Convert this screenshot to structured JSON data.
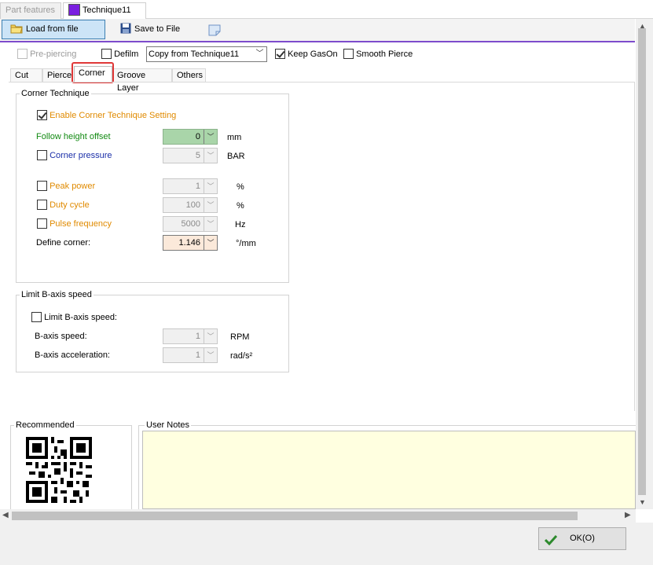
{
  "tabs": {
    "part_features": "Part features",
    "technique": "Technique11"
  },
  "toolbar": {
    "load": "Load from file",
    "save": "Save to File"
  },
  "options": {
    "pre_piercing": "Pre-piercing",
    "defilm": "Defilm",
    "copy_from": "Copy from Technique11",
    "keep_gas_on": "Keep GasOn",
    "smooth_pierce": "Smooth Pierce"
  },
  "subtabs": [
    "Cut",
    "Pierce",
    "Corner",
    "Groove Layer",
    "Others"
  ],
  "corner_group": {
    "title": "Corner Technique",
    "enable": "Enable Corner Technique Setting",
    "follow_height": {
      "label": "Follow height offset",
      "value": "0",
      "unit": "mm"
    },
    "corner_pressure": {
      "label": "Corner pressure",
      "value": "5",
      "unit": "BAR"
    },
    "peak_power": {
      "label": "Peak power",
      "value": "1",
      "unit": "%"
    },
    "duty_cycle": {
      "label": "Duty cycle",
      "value": "100",
      "unit": "%"
    },
    "pulse_frequency": {
      "label": "Pulse frequency",
      "value": "5000",
      "unit": "Hz"
    },
    "define_corner": {
      "label": "Define corner:",
      "value": "1.146",
      "unit": "°/mm"
    }
  },
  "baxis_group": {
    "title": "Limit B-axis speed",
    "limit": "Limit B-axis speed:",
    "speed": {
      "label": "B-axis speed:",
      "value": "1",
      "unit": "RPM"
    },
    "accel": {
      "label": "B-axis acceleration:",
      "value": "1",
      "unit": "rad/s²"
    }
  },
  "recommended": "Recommended",
  "user_notes": "User Notes",
  "ok": "OK(O)",
  "colors": {
    "accent_purple": "#7d4bcc",
    "technique_swatch": "#7a1fe0",
    "highlight_red": "#e03838"
  }
}
